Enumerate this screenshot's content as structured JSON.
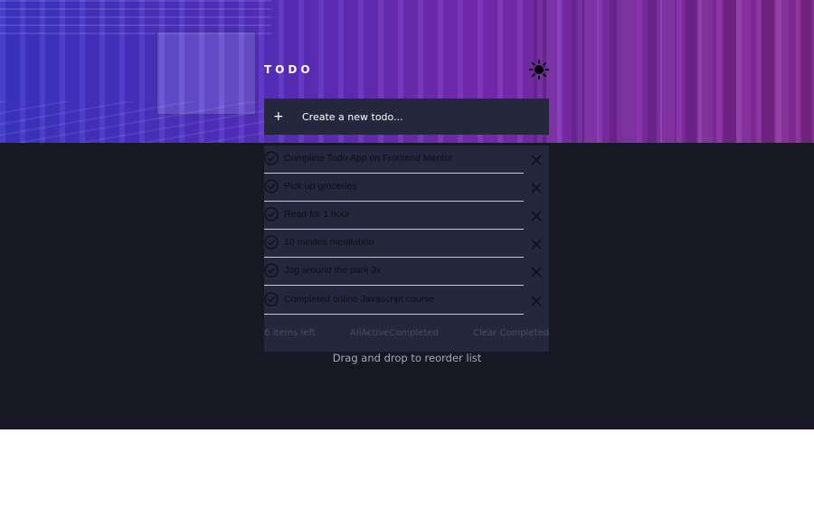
{
  "header": {
    "title": "TODO",
    "theme_icon": "sun-icon"
  },
  "new_todo": {
    "icon": "plus-icon",
    "icon_glyph": "+",
    "placeholder": "Create a new todo..."
  },
  "todos": [
    {
      "text": "Complete Todo App on Frontend Mentor"
    },
    {
      "text": "Pick up groceries"
    },
    {
      "text": "Read for 1 hour"
    },
    {
      "text": "10 minites meditation"
    },
    {
      "text": "Jog around the park 3x"
    },
    {
      "text": "Completed online Javascript course"
    }
  ],
  "footer": {
    "items_left": "6 items left",
    "filters": {
      "all": "All",
      "active": "Active",
      "completed": "Completed"
    },
    "clear": "Clear Completed"
  },
  "hint": "Drag and drop to reorder list",
  "colors": {
    "background": "#181824",
    "card": "#25273c",
    "gradient_start": "#3d35c9",
    "gradient_end": "#8a2a9a"
  }
}
